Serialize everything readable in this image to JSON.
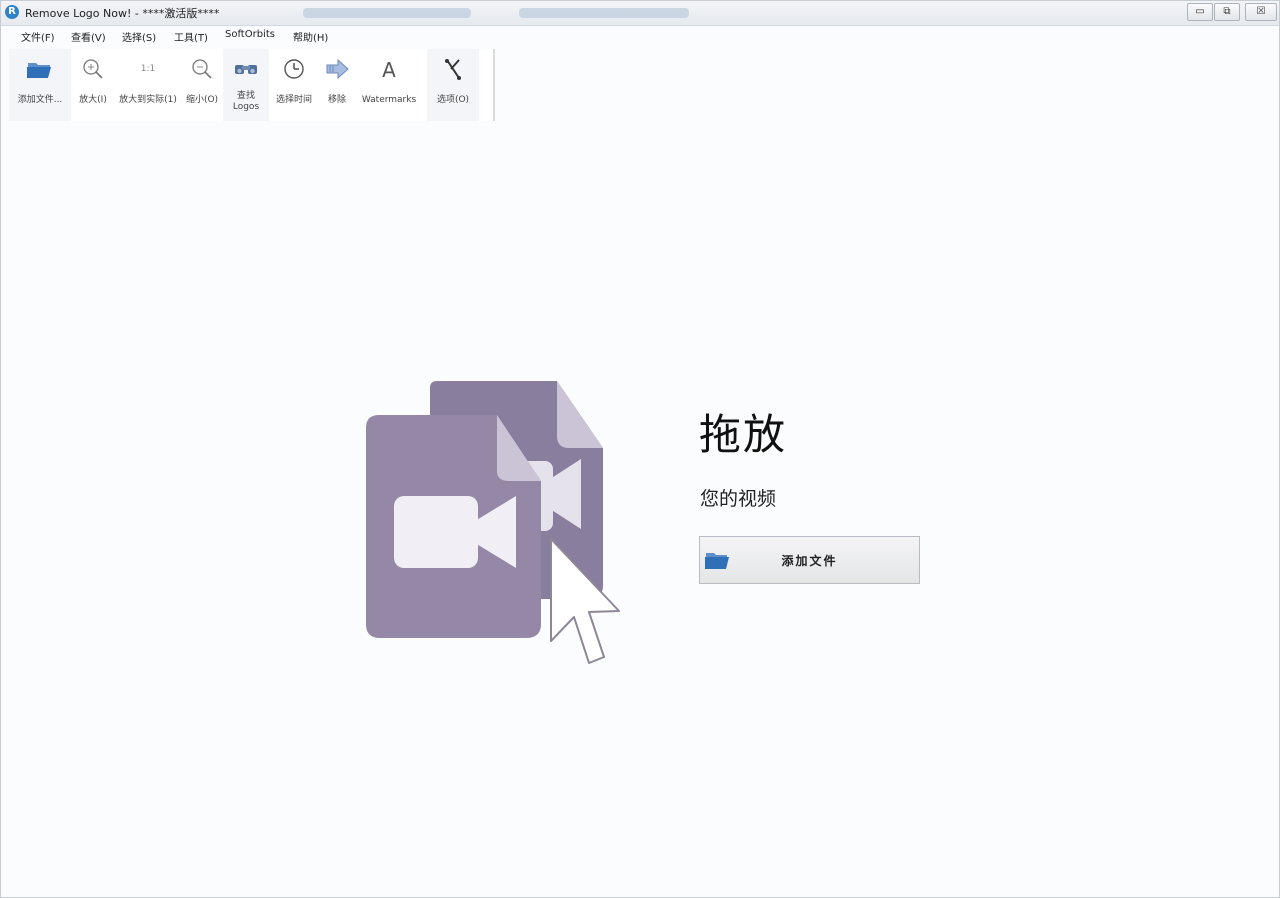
{
  "window": {
    "title": "Remove Logo Now! - ****激活版****",
    "controls": {
      "minimize": "▭",
      "maximize": "⧉",
      "close": "☒"
    }
  },
  "menu": [
    "文件(F)",
    "查看(V)",
    "选择(S)",
    "工具(T)",
    "SoftOrbits",
    "帮助(H)"
  ],
  "toolbar": [
    {
      "label": "添加文件...",
      "icon": "folder-open-icon"
    },
    {
      "label": "放大(I)",
      "icon": "zoom-in-icon"
    },
    {
      "label": "放大到实际(1)",
      "icon": "zoom-actual-icon",
      "icon_text": "1:1"
    },
    {
      "label": "缩小(O)",
      "icon": "zoom-out-icon"
    },
    {
      "label": "查找\nLogos",
      "icon": "binoculars-icon"
    },
    {
      "label": "选择时间",
      "icon": "clock-icon"
    },
    {
      "label": "移除",
      "icon": "arrow-right-icon"
    },
    {
      "label": "Watermarks",
      "icon": "letter-a-icon",
      "icon_text": "A"
    },
    {
      "label": "选项(O)",
      "icon": "tools-icon"
    }
  ],
  "drop_area": {
    "title": "拖放",
    "subtitle": "您的视频",
    "add_button_label": "添加文件"
  },
  "colors": {
    "hero_file_back": "#8a7e9e",
    "hero_file_front": "#9488a6",
    "hero_fold": "#cbc4d6",
    "folder_blue": "#2f6fb8"
  }
}
